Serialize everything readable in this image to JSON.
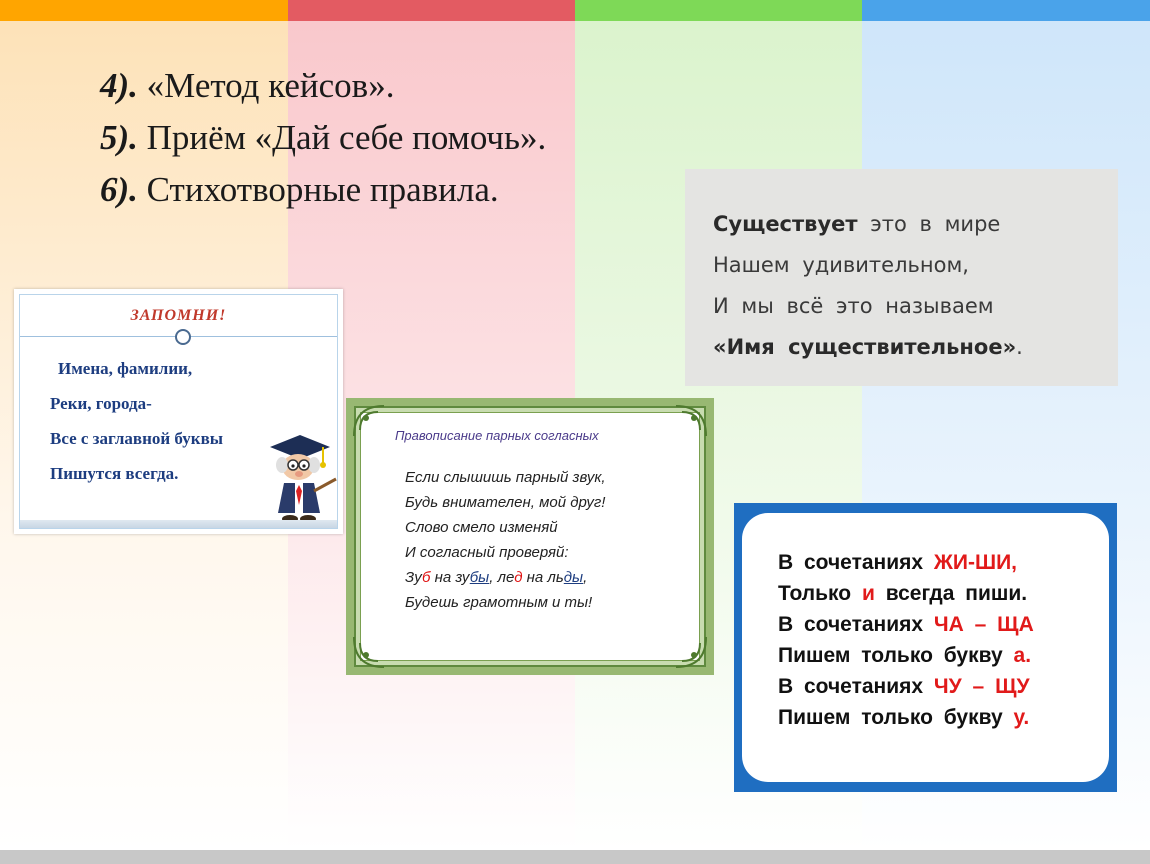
{
  "slide": {
    "top_colors": [
      "#ffa500",
      "#e35b62",
      "#7ed957",
      "#4aa3ea"
    ],
    "items": [
      {
        "num": "4).",
        "text": " «Метод кейсов»."
      },
      {
        "num": "5).",
        "text": " Приём «Дай себе помочь»."
      },
      {
        "num": "6).",
        "text": " Стихотворные правила."
      }
    ]
  },
  "card_remember": {
    "title": "ЗАПОМНИ!",
    "lines": [
      "Имена, фамилии,",
      "Реки, города-",
      "Все с заглавной буквы",
      "Пишутся всегда."
    ]
  },
  "card_consonants": {
    "title": "Правописание парных согласных",
    "line1": "Если слышишь парный звук,",
    "line2": "Будь внимателен, мой друг!",
    "line3": "Слово смело изменяй",
    "line4": "И согласный проверяй:",
    "line5": {
      "p1": "Зу",
      "p2": "б",
      "p3": " на зу",
      "p4": "бы",
      "p5": ", ле",
      "p6": "д",
      "p7": " на ль",
      "p8": "ды",
      "p9": ","
    },
    "line6": "Будешь грамотным и ты!"
  },
  "card_noun": {
    "line1_bold": "Существует",
    "line1_rest": " это в мире",
    "line2": "Нашем удивительном,",
    "line3": "И мы всё это называем",
    "line4_bold": "«Имя существительное»",
    "line4_rest": "."
  },
  "card_zhishi": {
    "l1a": "В сочетаниях ",
    "l1b": "ЖИ-ШИ,",
    "l2a": "Только ",
    "l2b": "и",
    "l2c": " всегда пиши.",
    "l3a": "В сочетаниях ",
    "l3b": "ЧА – ЩА",
    "l4a": "Пишем только букву ",
    "l4b": "а.",
    "l5a": "В сочетаниях ",
    "l5b": "ЧУ – ЩУ",
    "l6a": "Пишем только букву ",
    "l6b": "у."
  }
}
